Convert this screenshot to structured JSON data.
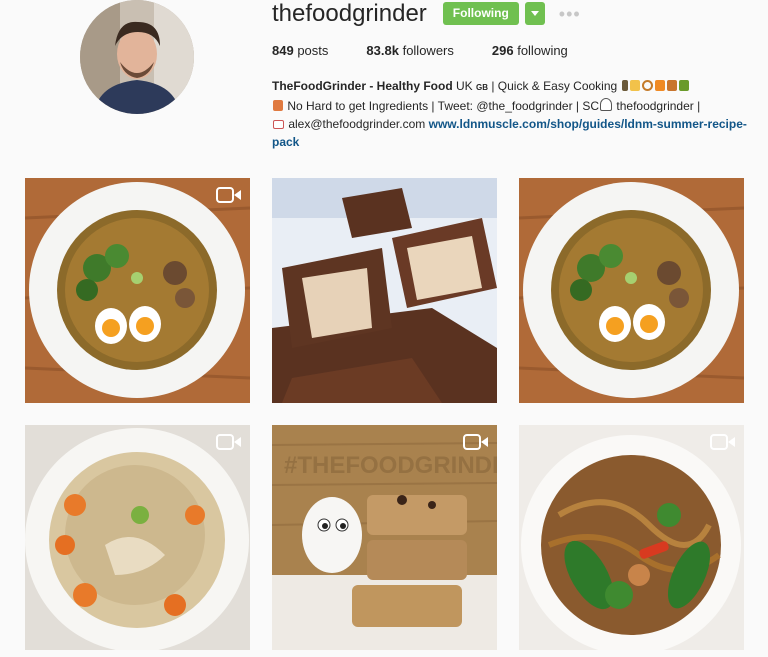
{
  "profile": {
    "username": "thefoodgrinder",
    "follow_label": "Following",
    "more_label": "•••",
    "stats": [
      {
        "value": "849",
        "label": "posts"
      },
      {
        "value": "83.8k",
        "label": "followers"
      },
      {
        "value": "296",
        "label": "following"
      }
    ],
    "bio": {
      "name": "TheFoodGrinder - Healthy Food",
      "line1_rest": " UK ",
      "flag_text": "GB",
      "line1_tail": " | Quick & Easy Cooking",
      "line2": " No Hard to get Ingredients | Tweet: @the_foodgrinder | SC",
      "line2_tail": " thefoodgrinder |",
      "email": " alex@thefoodgrinder.com",
      "link": "www.ldnmuscle.com/shop/guides/ldnm-summer-recipe-pack"
    },
    "accent_color": "#70c050"
  },
  "posts": [
    {
      "label": "ramen bowl with eggs and broccoli",
      "type": "video"
    },
    {
      "label": "chocolate protein bars",
      "type": "photo"
    },
    {
      "label": "ramen bowl with eggs and broccoli",
      "type": "video"
    },
    {
      "label": "chicken and carrot stew",
      "type": "video"
    },
    {
      "label": "egg and flapjack squares",
      "type": "video"
    },
    {
      "label": "chicken noodle stir fry",
      "type": "video"
    }
  ]
}
